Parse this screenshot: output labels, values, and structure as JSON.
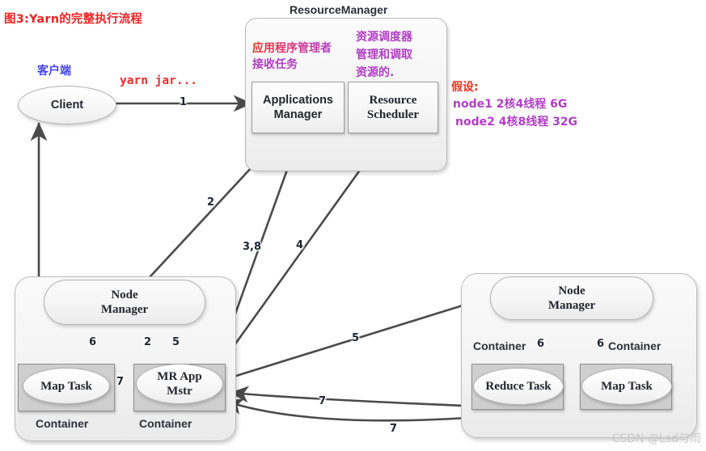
{
  "figure": {
    "title": "图3:Yarn的完整执行流程",
    "watermark": "CSDN @Lsd与雨"
  },
  "client": {
    "cn_label": "客户端",
    "label": "Client",
    "command": "yarn jar..."
  },
  "resource_manager": {
    "caption": "ResourceManager",
    "annotations": {
      "app_manager_cn": "应用程序管理者",
      "app_manager_cn2": "接收任务",
      "scheduler_cn1": "资源调度器",
      "scheduler_cn2": "管理和调取",
      "scheduler_cn3": "资源的."
    },
    "boxes": [
      {
        "line1": "Applications",
        "line2": "Manager"
      },
      {
        "line1": "Resource",
        "line2": "Scheduler"
      }
    ]
  },
  "assumption": {
    "heading": "假设:",
    "line1": "node1   2核4线程 6G",
    "line2": "node2   4核8线程 32G"
  },
  "node_left": {
    "manager_line1": "Node",
    "manager_line2": "Manager",
    "containers": [
      {
        "caption": "Container",
        "task": "Map Task"
      },
      {
        "caption": "Container",
        "task": "MR App Mstr",
        "task_line1": "MR App",
        "task_line2": "Mstr"
      }
    ]
  },
  "node_right": {
    "manager_line1": "Node",
    "manager_line2": "Manager",
    "containers": [
      {
        "caption": "Container",
        "task": "Reduce Task"
      },
      {
        "caption": "Container",
        "task": "Map Task"
      }
    ]
  },
  "steps": {
    "s1": "1",
    "s2_rm": "2",
    "s38": "3,8",
    "s4": "4",
    "s5_right": "5",
    "s6_left": "6",
    "s2_left": "2",
    "s5_left": "5",
    "s7_left": "7",
    "s7_bottom": "7",
    "s6_right_a": "6",
    "s6_right_b": "6"
  },
  "colors": {
    "title_red": "#ee2222",
    "annotation_red": "#ee3322",
    "annotation_purple": "#b13fc4",
    "client_blue": "#4545e8",
    "wire": "#4a4a4a",
    "container_fill": "#cfcfcf"
  }
}
